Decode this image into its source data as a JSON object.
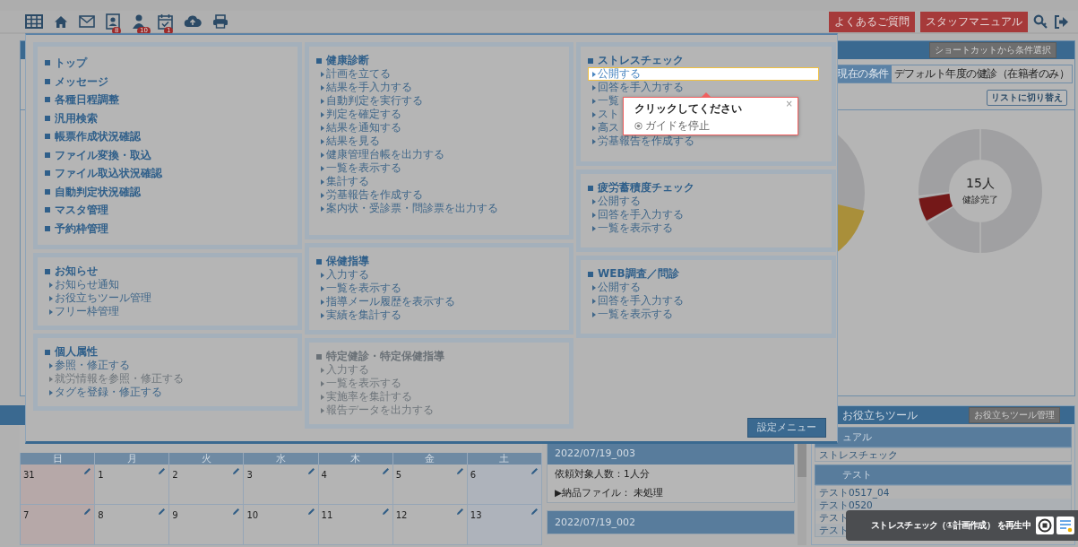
{
  "toolbar": {
    "badges": [
      "8",
      "10",
      "1"
    ],
    "buttons": [
      "よくあるご質問",
      "スタッフマニュアル"
    ]
  },
  "dashboard": {
    "shortcut_button": "ショートカットから条件選択",
    "condition_label": "現在の条件",
    "condition_value": "デフォルト年度の健診（在籍者のみ）",
    "list_button": "リストに切り替え",
    "donut_count": "15人",
    "donut_caption": "健診完了"
  },
  "calendar": {
    "weekdays": [
      "日",
      "月",
      "火",
      "水",
      "木",
      "金",
      "土"
    ],
    "weeks": [
      [
        "31",
        "1",
        "2",
        "3",
        "4",
        "5",
        "6"
      ],
      [
        "7",
        "8",
        "9",
        "10",
        "11",
        "12",
        "13"
      ]
    ]
  },
  "deliveries": [
    {
      "title": "2022/07/19_003",
      "lines": [
        "依頼対象人数：1人分",
        "▶納品ファイル： 未処理"
      ]
    },
    {
      "title": "2022/07/19_002"
    }
  ],
  "tools": {
    "title": "お役立ちツール",
    "manage_button": "お役立ちツール管理",
    "categories": [
      {
        "name": "ュアル",
        "items": [
          "ストレスチェック"
        ]
      },
      {
        "name": "テスト",
        "items": [
          "テスト0517_04",
          "テスト0520",
          "テスト",
          "テスト"
        ]
      }
    ]
  },
  "menu": {
    "columns": [
      [
        {
          "kind": "headings",
          "items": [
            "トップ",
            "メッセージ",
            "各種日程調整",
            "汎用検索",
            "帳票作成状況確認",
            "ファイル変換・取込",
            "ファイル取込状況確認",
            "自動判定状況確認",
            "マスタ管理",
            "予約枠管理"
          ]
        },
        {
          "kind": "group",
          "title": "お知らせ",
          "disabled": false,
          "links": [
            {
              "label": "お知らせ通知",
              "disabled": false,
              "highlighted": false
            },
            {
              "label": "お役立ちツール管理",
              "disabled": false,
              "highlighted": false
            },
            {
              "label": "フリー枠管理",
              "disabled": false,
              "highlighted": false
            }
          ]
        },
        {
          "kind": "group",
          "title": "個人属性",
          "disabled": false,
          "links": [
            {
              "label": "参照・修正する",
              "disabled": false,
              "highlighted": false
            },
            {
              "label": "就労情報を参照・修正する",
              "disabled": true,
              "highlighted": false
            },
            {
              "label": "タグを登録・修正する",
              "disabled": false,
              "highlighted": false
            }
          ]
        }
      ],
      [
        {
          "kind": "group",
          "title": "健康診断",
          "disabled": false,
          "links": [
            {
              "label": "計画を立てる",
              "disabled": false,
              "highlighted": false
            },
            {
              "label": "結果を手入力する",
              "disabled": false,
              "highlighted": false
            },
            {
              "label": "自動判定を実行する",
              "disabled": false,
              "highlighted": false
            },
            {
              "label": "判定を確定する",
              "disabled": false,
              "highlighted": false
            },
            {
              "label": "結果を通知する",
              "disabled": false,
              "highlighted": false
            },
            {
              "label": "結果を見る",
              "disabled": false,
              "highlighted": false
            },
            {
              "label": "健康管理台帳を出力する",
              "disabled": false,
              "highlighted": false
            },
            {
              "label": "一覧を表示する",
              "disabled": false,
              "highlighted": false
            },
            {
              "label": "集計する",
              "disabled": false,
              "highlighted": false
            },
            {
              "label": "労基報告を作成する",
              "disabled": false,
              "highlighted": false
            },
            {
              "label": "案内状・受診票・問診票を出力する",
              "disabled": false,
              "highlighted": false
            }
          ]
        },
        {
          "kind": "group",
          "title": "保健指導",
          "disabled": false,
          "links": [
            {
              "label": "入力する",
              "disabled": false,
              "highlighted": false
            },
            {
              "label": "一覧を表示する",
              "disabled": false,
              "highlighted": false
            },
            {
              "label": "指導メール履歴を表示する",
              "disabled": false,
              "highlighted": false
            },
            {
              "label": "実績を集計する",
              "disabled": false,
              "highlighted": false
            }
          ]
        },
        {
          "kind": "group",
          "title": "特定健診・特定保健指導",
          "disabled": true,
          "links": [
            {
              "label": "入力する",
              "disabled": true,
              "highlighted": false
            },
            {
              "label": "一覧を表示する",
              "disabled": true,
              "highlighted": false
            },
            {
              "label": "実施率を集計する",
              "disabled": true,
              "highlighted": false
            },
            {
              "label": "報告データを出力する",
              "disabled": true,
              "highlighted": false
            }
          ]
        }
      ],
      [
        {
          "kind": "group",
          "title": "ストレスチェック",
          "disabled": false,
          "links": [
            {
              "label": "公開する",
              "disabled": false,
              "highlighted": true
            },
            {
              "label": "回答を手入力する",
              "disabled": false,
              "highlighted": false
            },
            {
              "label": "一覧",
              "disabled": false,
              "highlighted": false
            },
            {
              "label": "スト",
              "disabled": false,
              "highlighted": false
            },
            {
              "label": "高ス",
              "disabled": false,
              "highlighted": false
            },
            {
              "label": "労基報告を作成する",
              "disabled": false,
              "highlighted": false
            }
          ]
        },
        {
          "kind": "group",
          "title": "疲労蓄積度チェック",
          "disabled": false,
          "links": [
            {
              "label": "公開する",
              "disabled": false,
              "highlighted": false
            },
            {
              "label": "回答を手入力する",
              "disabled": false,
              "highlighted": false
            },
            {
              "label": "一覧を表示する",
              "disabled": false,
              "highlighted": false
            }
          ]
        },
        {
          "kind": "group",
          "title": "WEB調査／問診",
          "disabled": false,
          "links": [
            {
              "label": "公開する",
              "disabled": false,
              "highlighted": false
            },
            {
              "label": "回答を手入力する",
              "disabled": false,
              "highlighted": false
            },
            {
              "label": "一覧を表示する",
              "disabled": false,
              "highlighted": false
            }
          ]
        }
      ]
    ],
    "settings_button": "設定メニュー"
  },
  "guide": {
    "title": "クリックしてください",
    "close": "×",
    "stop_label": "ガイドを停止"
  },
  "toast": {
    "text": "ストレスチェック（①計画作成） を再生中"
  }
}
